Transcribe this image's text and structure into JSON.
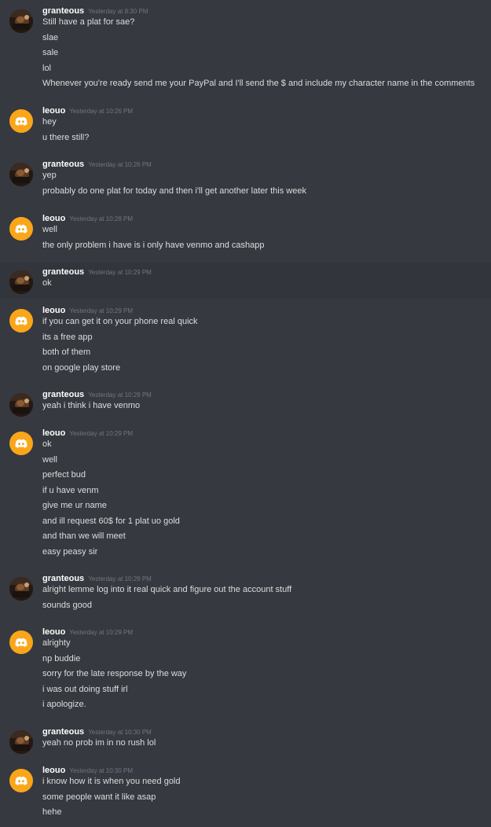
{
  "colors": {
    "background": "#36393f",
    "username": "#ffffff",
    "message_text": "#dcddde",
    "timestamp": "#72767d",
    "discord_avatar": "#faa61a"
  },
  "messages": [
    {
      "author": "granteous",
      "avatar": "photo-avatar",
      "timestamp": "Yesterday at 8:30 PM",
      "lines": [
        "Still have a plat for sae?",
        "slae",
        "sale",
        "lol",
        "Whenever you're ready send me your PayPal and I'll send the $ and include my character name in the comments"
      ]
    },
    {
      "author": "leouo",
      "avatar": "discord-avatar",
      "timestamp": "Yesterday at 10:26 PM",
      "lines": [
        "hey",
        "u there still?"
      ]
    },
    {
      "author": "granteous",
      "avatar": "photo-avatar",
      "timestamp": "Yesterday at 10:26 PM",
      "lines": [
        "yep",
        "probably do one plat for today and then i'll get another later this week"
      ]
    },
    {
      "author": "leouo",
      "avatar": "discord-avatar",
      "timestamp": "Yesterday at 10:28 PM",
      "lines": [
        "well",
        "the only problem i have is i only have venmo and cashapp"
      ]
    },
    {
      "author": "granteous",
      "avatar": "photo-avatar",
      "timestamp": "Yesterday at 10:29 PM",
      "lines": [
        "ok"
      ]
    },
    {
      "author": "leouo",
      "avatar": "discord-avatar",
      "timestamp": "Yesterday at 10:29 PM",
      "lines": [
        "if you can get it on your phone real quick",
        "its a free app",
        "both of them",
        "on google play store"
      ]
    },
    {
      "author": "granteous",
      "avatar": "photo-avatar",
      "timestamp": "Yesterday at 10:29 PM",
      "lines": [
        "yeah i think i have venmo"
      ]
    },
    {
      "author": "leouo",
      "avatar": "discord-avatar",
      "timestamp": "Yesterday at 10:29 PM",
      "lines": [
        "ok",
        "well",
        "perfect bud",
        "if u have venm",
        "give me ur name",
        "and ill request 60$ for 1 plat uo gold",
        "and than we will meet",
        "easy peasy sir"
      ]
    },
    {
      "author": "granteous",
      "avatar": "photo-avatar",
      "timestamp": "Yesterday at 10:29 PM",
      "lines": [
        "alright lemme log into it real quick and figure out the account stuff",
        "sounds good"
      ]
    },
    {
      "author": "leouo",
      "avatar": "discord-avatar",
      "timestamp": "Yesterday at 10:29 PM",
      "lines": [
        "alrighty",
        "np buddie",
        "sorry for the late response by the way",
        "i was out doing stuff irl",
        "i apologize."
      ]
    },
    {
      "author": "granteous",
      "avatar": "photo-avatar",
      "timestamp": "Yesterday at 10:30 PM",
      "lines": [
        "yeah no prob im in no rush lol"
      ]
    },
    {
      "author": "leouo",
      "avatar": "discord-avatar",
      "timestamp": "Yesterday at 10:30 PM",
      "lines": [
        "i know how it is when you need gold",
        "some people want it like asap",
        "hehe"
      ]
    }
  ]
}
